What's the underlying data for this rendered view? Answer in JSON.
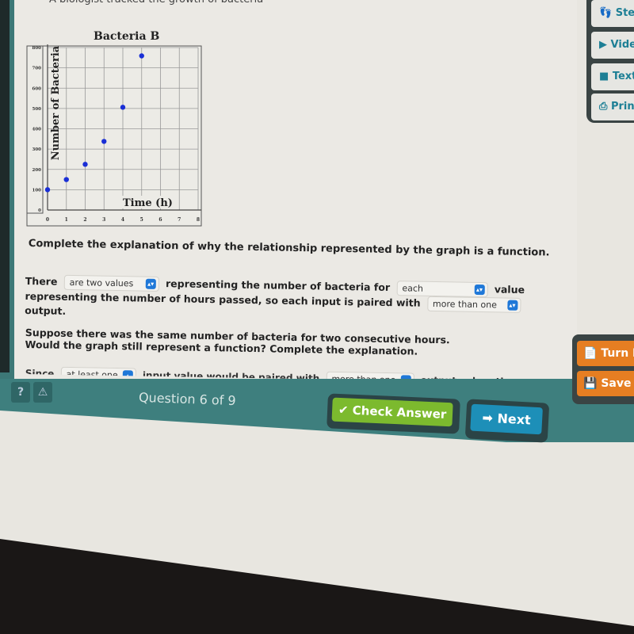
{
  "intro_text": "A biologist tracked the growth of bacteria",
  "chart_data": {
    "type": "scatter",
    "title": "Bacteria B",
    "xlabel": "Time (h)",
    "ylabel": "Number of Bacteria",
    "x": [
      0,
      1,
      2,
      3,
      4,
      5
    ],
    "y": [
      100,
      150,
      225,
      338,
      506,
      759
    ],
    "xlim": [
      0,
      8
    ],
    "ylim": [
      0,
      800
    ],
    "x_ticks": [
      "0",
      "1",
      "2",
      "3",
      "4",
      "5",
      "6",
      "7",
      "8"
    ],
    "y_ticks": [
      "0",
      "100",
      "200",
      "300",
      "400",
      "500",
      "600",
      "700",
      "800"
    ],
    "grid": true,
    "point_color": "#1a2fd6"
  },
  "question": {
    "prompt": "Complete the explanation of why the relationship represented by the graph is a function.",
    "p1_there": "There",
    "p1_select1": "are two values",
    "p1_mid": "representing the number of bacteria for",
    "p1_select2": "each",
    "p1_value": "value",
    "p1_line2": "representing the number of hours passed, so each input is paired with",
    "p1_select3": "more than one",
    "p1_output": "output.",
    "p2": "Suppose there was the same number of bacteria for two consecutive hours. Would the graph still represent a function? Complete the explanation.",
    "p3_since": "Since",
    "p3_select1": "at least one",
    "p3_mid": "input value would be paired with",
    "p3_select2": "more than one",
    "p3_end": "output value, the"
  },
  "footer": {
    "help": "?",
    "warn": "⚠",
    "question_count": "Question 6 of 9",
    "check_answer": "Check Answer",
    "check_icon": "✔",
    "next": "Next",
    "next_icon": "➡"
  },
  "side_tools": [
    {
      "icon": "footprint-icon",
      "glyph": "👣",
      "label": "Steps"
    },
    {
      "icon": "video-icon",
      "glyph": "▶",
      "label": "Video"
    },
    {
      "icon": "textbook-icon",
      "glyph": "■",
      "label": "Textbook"
    },
    {
      "icon": "print-icon",
      "glyph": "⎙",
      "label": "Print"
    }
  ],
  "side_actions": [
    {
      "icon": "turn-in-icon",
      "glyph": "📄",
      "label": "Turn In"
    },
    {
      "icon": "save-icon",
      "glyph": "💾",
      "label": "Save & Exit"
    }
  ]
}
